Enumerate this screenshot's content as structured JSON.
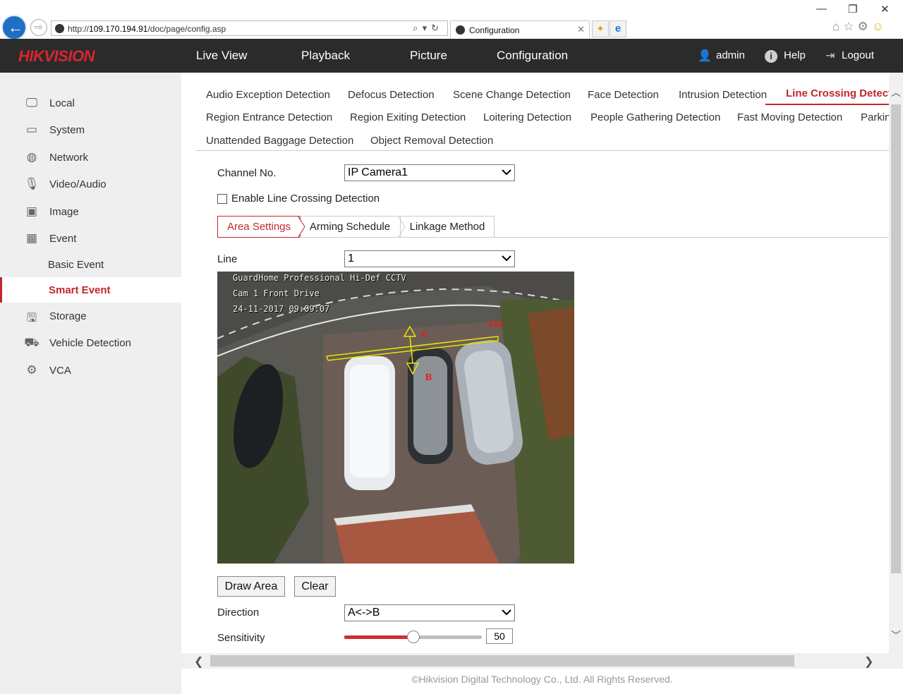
{
  "browser": {
    "url_prefix": "http://",
    "url_host": "109.170.194.91",
    "url_path": "/doc/page/config.asp",
    "tab_title": "Configuration"
  },
  "header": {
    "logo": "HIKVISION",
    "nav": [
      "Live View",
      "Playback",
      "Picture",
      "Configuration"
    ],
    "user": "admin",
    "help": "Help",
    "logout": "Logout"
  },
  "sidebar": {
    "items": [
      {
        "label": "Local",
        "icon": "monitor-icon"
      },
      {
        "label": "System",
        "icon": "system-icon"
      },
      {
        "label": "Network",
        "icon": "globe-icon"
      },
      {
        "label": "Video/Audio",
        "icon": "microphone-camera-icon"
      },
      {
        "label": "Image",
        "icon": "image-icon"
      },
      {
        "label": "Event",
        "icon": "calendar-icon"
      },
      {
        "label": "Basic Event"
      },
      {
        "label": "Smart Event"
      },
      {
        "label": "Storage",
        "icon": "disk-icon"
      },
      {
        "label": "Vehicle Detection",
        "icon": "vehicle-search-icon"
      },
      {
        "label": "VCA",
        "icon": "vca-gear-icon"
      }
    ],
    "active": "Smart Event"
  },
  "event_tabs": [
    "Audio Exception Detection",
    "Defocus Detection",
    "Scene Change Detection",
    "Face Detection",
    "Intrusion Detection",
    "Line Crossing Detecti",
    "Region Entrance Detection",
    "Region Exiting Detection",
    "Loitering Detection",
    "People Gathering Detection",
    "Fast Moving Detection",
    "Parkin",
    "Unattended Baggage Detection",
    "Object Removal Detection"
  ],
  "form": {
    "channel_label": "Channel No.",
    "channel_value": "IP Camera1",
    "enable_label": "Enable Line Crossing Detection",
    "enable_checked": false,
    "sub_tabs": [
      "Area Settings",
      "Arming Schedule",
      "Linkage Method"
    ],
    "active_sub_tab": "Area Settings",
    "line_label": "Line",
    "line_value": "1",
    "draw_button": "Draw Area",
    "clear_button": "Clear",
    "direction_label": "Direction",
    "direction_value": "A<->B",
    "sensitivity_label": "Sensitivity",
    "sensitivity_value": "50",
    "sensitivity_fraction": 0.5
  },
  "camera": {
    "osd_line1": "GuardHome Professional Hi-Def CCTV",
    "osd_line2": "Cam 1 Front Drive",
    "osd_line3": "24-11-2017 09:09:07",
    "marker_a": "A",
    "marker_b": "B",
    "line_tag": "#1#"
  },
  "footer": "©Hikvision Digital Technology Co., Ltd. All Rights Reserved.",
  "colors": {
    "accent": "#c1272d",
    "header_bg": "#2b2b2b",
    "sidebar_bg": "#efefef"
  }
}
